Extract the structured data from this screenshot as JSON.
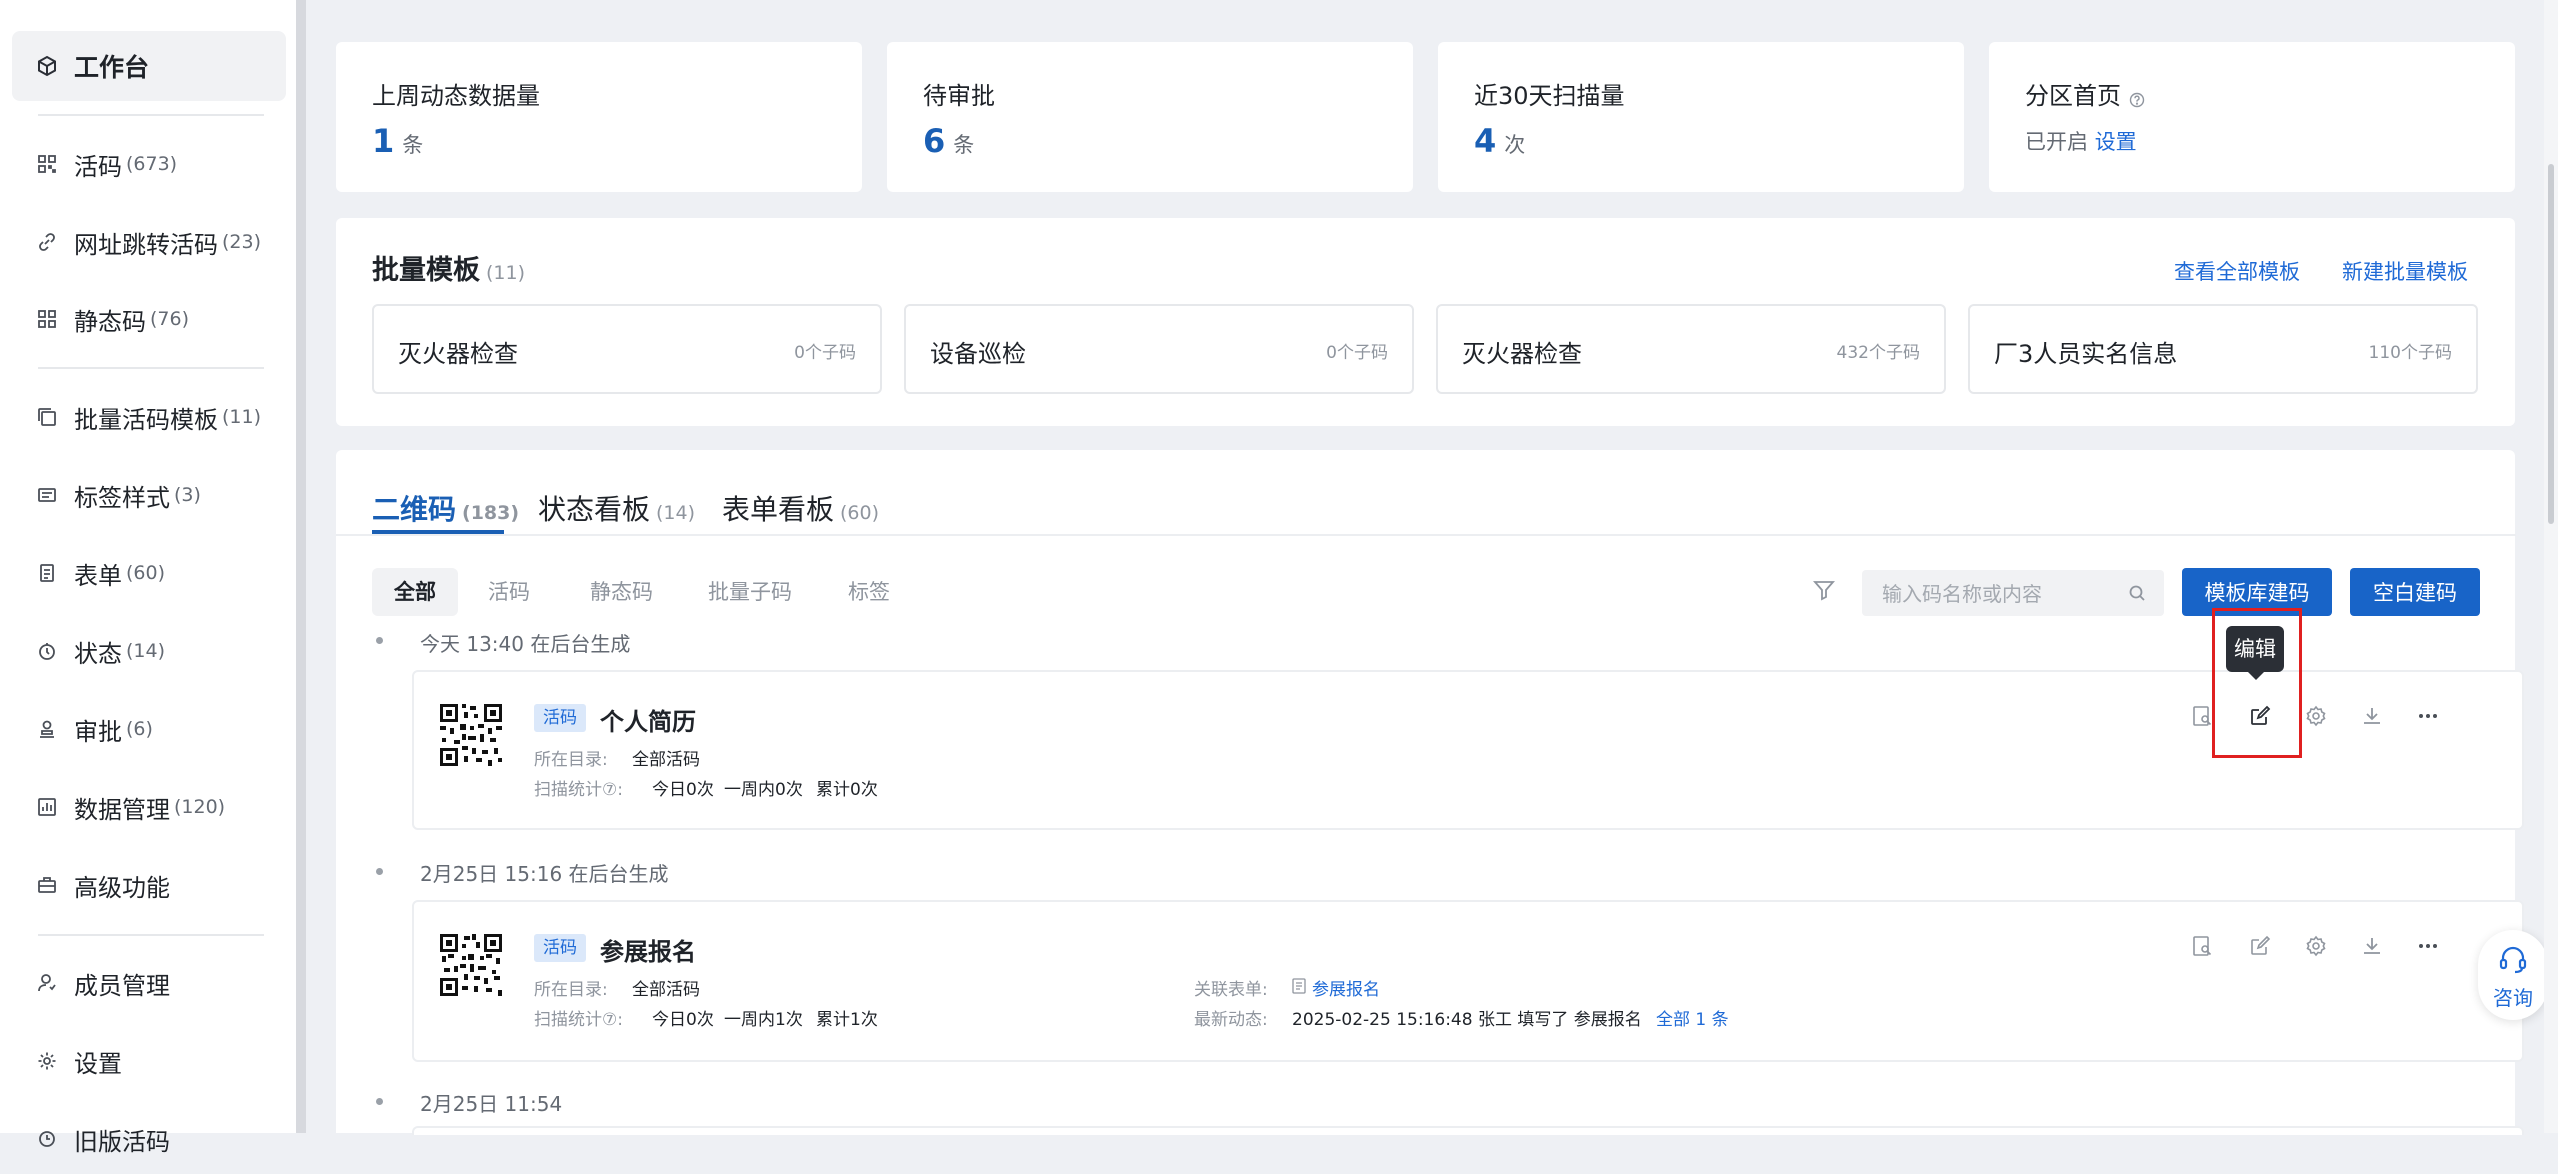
{
  "sidebar": {
    "items": [
      {
        "label": "工作台",
        "count": "",
        "icon": "cube-icon"
      },
      {
        "label": "活码",
        "count": "(673)",
        "icon": "qr-grid-icon"
      },
      {
        "label": "网址跳转活码",
        "count": "(23)",
        "icon": "link-icon"
      },
      {
        "label": "静态码",
        "count": "(76)",
        "icon": "qr-static-icon"
      },
      {
        "label": "批量活码模板",
        "count": "(11)",
        "icon": "stack-icon"
      },
      {
        "label": "标签样式",
        "count": "(3)",
        "icon": "label-icon"
      },
      {
        "label": "表单",
        "count": "(60)",
        "icon": "form-icon"
      },
      {
        "label": "状态",
        "count": "(14)",
        "icon": "status-icon"
      },
      {
        "label": "审批",
        "count": "(6)",
        "icon": "approval-icon"
      },
      {
        "label": "数据管理",
        "count": "(120)",
        "icon": "chart-icon"
      },
      {
        "label": "高级功能",
        "count": "",
        "icon": "briefcase-icon"
      },
      {
        "label": "成员管理",
        "count": "",
        "icon": "user-icon"
      },
      {
        "label": "设置",
        "count": "",
        "icon": "gear-icon"
      },
      {
        "label": "旧版活码",
        "count": "",
        "icon": "history-icon"
      }
    ]
  },
  "stats": [
    {
      "title": "上周动态数据量",
      "value": "1",
      "unit": "条"
    },
    {
      "title": "待审批",
      "value": "6",
      "unit": "条"
    },
    {
      "title": "近30天扫描量",
      "value": "4",
      "unit": "次"
    },
    {
      "title": "分区首页",
      "status": "已开启",
      "link": "设置"
    }
  ],
  "batch": {
    "title": "批量模板",
    "count": "(11)",
    "view_all": "查看全部模板",
    "new": "新建批量模板",
    "templates": [
      {
        "name": "灭火器检查",
        "count": "0个子码"
      },
      {
        "name": "设备巡检",
        "count": "0个子码"
      },
      {
        "name": "灭火器检查",
        "count": "432个子码"
      },
      {
        "name": "厂3人员实名信息",
        "count": "110个子码"
      }
    ]
  },
  "tabs": [
    {
      "label": "二维码",
      "count": "(183)"
    },
    {
      "label": "状态看板",
      "count": "(14)"
    },
    {
      "label": "表单看板",
      "count": "(60)"
    }
  ],
  "filters": [
    "全部",
    "活码",
    "静态码",
    "批量子码",
    "标签"
  ],
  "search": {
    "placeholder": "输入码名称或内容",
    "value": ""
  },
  "buttons": {
    "template_create": "模板库建码",
    "blank_create": "空白建码"
  },
  "tooltip": "编辑",
  "timeline": [
    {
      "time": "今天 13:40",
      "source": "在后台生成"
    },
    {
      "time": "2月25日 15:16",
      "source": "在后台生成"
    },
    {
      "time": "2月25日 11:54",
      "source": ""
    }
  ],
  "codes": [
    {
      "badge": "活码",
      "title": "个人简历",
      "dir_label": "所在目录:",
      "dir_value": "全部活码",
      "scan_label": "扫描统计⑦:",
      "scan_today": "今日0次",
      "scan_week": "一周内0次",
      "scan_total": "累计0次"
    },
    {
      "badge": "活码",
      "title": "参展报名",
      "dir_label": "所在目录:",
      "dir_value": "全部活码",
      "scan_label": "扫描统计⑦:",
      "scan_today": "今日0次",
      "scan_week": "一周内1次",
      "scan_total": "累计1次",
      "form_label": "关联表单:",
      "form_value": "参展报名",
      "latest_label": "最新动态:",
      "latest_value": "2025-02-25 15:16:48 张工 填写了 参展报名",
      "latest_link": "全部 1 条"
    }
  ],
  "consult": "咨询",
  "colors": {
    "accent": "#1864c8",
    "highlight": "#e02020"
  }
}
